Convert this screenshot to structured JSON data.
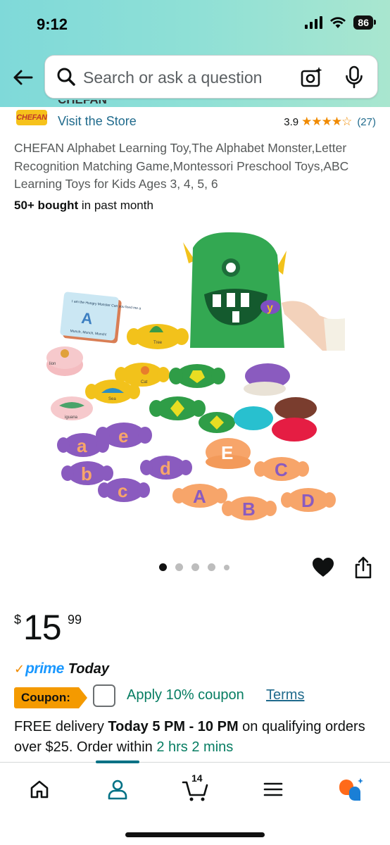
{
  "status_bar": {
    "time": "9:12",
    "battery": "86"
  },
  "search": {
    "placeholder": "Search or ask a question"
  },
  "store": {
    "brand_cut": "CHEFAN",
    "logo_text": "CHEFAN",
    "visit_label": "Visit the Store",
    "rating": "3.9",
    "stars": "★★★★☆",
    "rating_count": "(27)"
  },
  "product": {
    "title": "CHEFAN Alphabet Learning Toy,The Alphabet Monster,Letter Recognition Matching Game,Montessori Preschool Toys,ABC Learning Toys for Kids Ages 3, 4, 5, 6",
    "bought_strong": "50+ bought",
    "bought_rest": " in past month",
    "image_dots": 5,
    "image_index": 1
  },
  "image_labels": {
    "card_title": "I am the Hungry Monster Can you feed me a",
    "card_letter": "A",
    "card_footer": "Munch, Munch, Munch!",
    "mouth_letter": "y",
    "tree": "Tree",
    "cat": "Cat",
    "lion": "lion",
    "sea": "Sea",
    "iguana": "iguana",
    "candies": [
      "a",
      "b",
      "c",
      "d",
      "e",
      "E",
      "A",
      "B",
      "C",
      "D"
    ]
  },
  "price": {
    "symbol": "$",
    "whole": "15",
    "fraction": "99"
  },
  "prime": {
    "check": "✓",
    "word": "prime",
    "today": "Today"
  },
  "coupon": {
    "tag": "Coupon:",
    "apply": "Apply 10% coupon",
    "terms": "Terms"
  },
  "delivery": {
    "prefix": "FREE delivery ",
    "window": "Today 5 PM - 10 PM",
    "middle": " on qualifying orders over $25. Order within ",
    "countdown": "2 hrs 2 mins"
  },
  "nav": {
    "cart_count": "14"
  },
  "colors": {
    "accent": "#007185",
    "link": "#1f6a8c",
    "green": "#067d62",
    "star": "#f08a00",
    "coupon": "#f49a00"
  }
}
